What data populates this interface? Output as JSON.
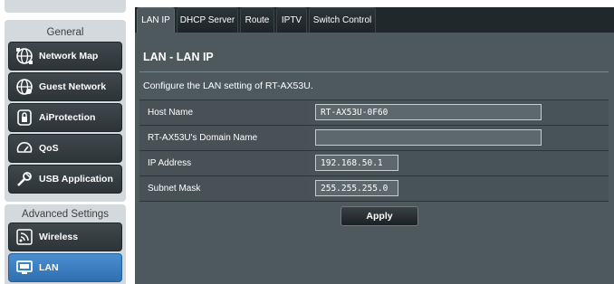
{
  "sidebar": {
    "general_header": "General",
    "general_items": [
      {
        "label": "Network Map",
        "icon": "globe-network-icon"
      },
      {
        "label": "Guest Network",
        "icon": "guest-globe-icon"
      },
      {
        "label": "AiProtection",
        "icon": "lock-shield-icon"
      },
      {
        "label": "QoS",
        "icon": "speedometer-icon"
      },
      {
        "label": "USB Application",
        "icon": "usb-tools-icon"
      }
    ],
    "advanced_header": "Advanced Settings",
    "advanced_items": [
      {
        "label": "Wireless",
        "icon": "wireless-icon"
      },
      {
        "label": "LAN",
        "icon": "lan-monitor-icon",
        "active": true
      }
    ]
  },
  "tabs": [
    {
      "label": "LAN IP",
      "active": true
    },
    {
      "label": "DHCP Server"
    },
    {
      "label": "Route"
    },
    {
      "label": "IPTV"
    },
    {
      "label": "Switch Control"
    }
  ],
  "page": {
    "title": "LAN - LAN IP",
    "description": "Configure the LAN setting of RT-AX53U."
  },
  "form": {
    "rows": [
      {
        "label": "Host Name",
        "value": "RT-AX53U-0F60"
      },
      {
        "label": "RT-AX53U's Domain Name",
        "value": ""
      },
      {
        "label": "IP Address",
        "value": "192.168.50.1"
      },
      {
        "label": "Subnet Mask",
        "value": "255.255.255.0"
      }
    ],
    "apply_label": "Apply"
  },
  "colors": {
    "panel_bg": "#4d595d",
    "tab_bar": "#21282b",
    "active_menu": "#3a7fc1",
    "menu_dark": "#363e42"
  }
}
